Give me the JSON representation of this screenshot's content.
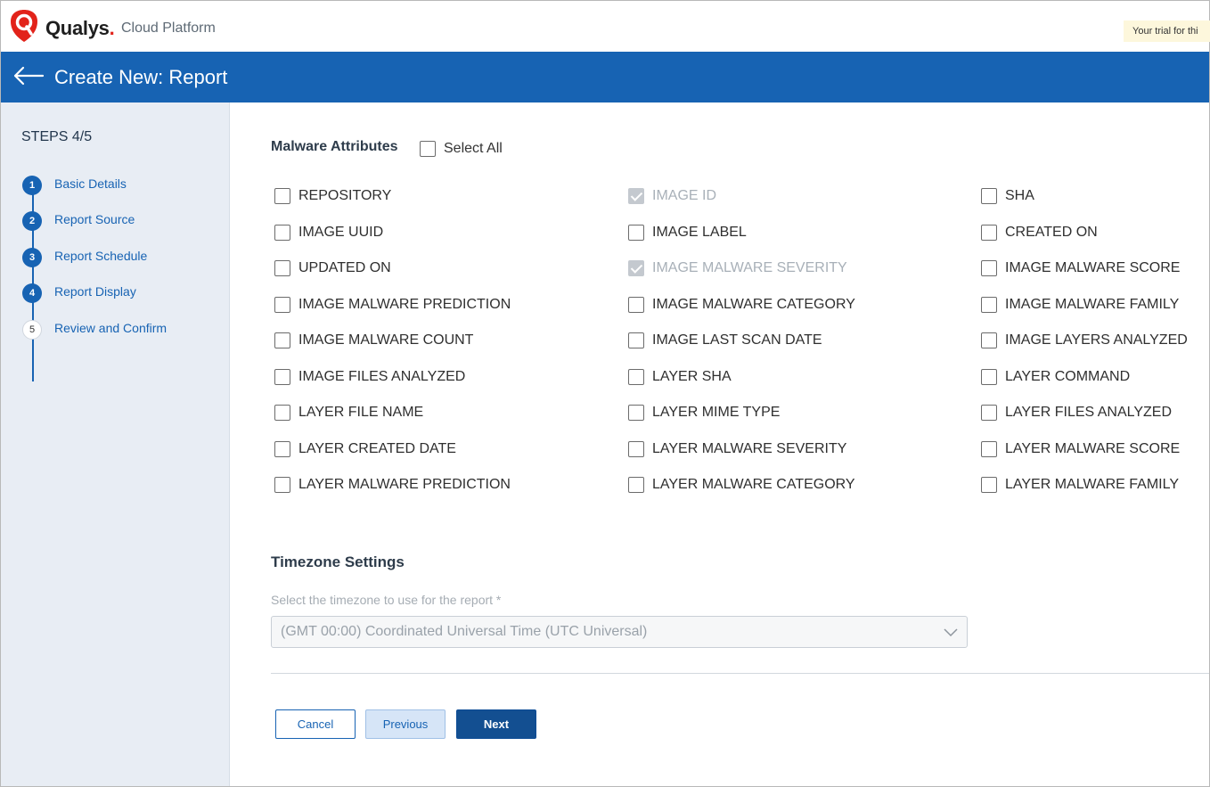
{
  "app": {
    "brand": "Qualys",
    "brand_dot": ".",
    "platform": "Cloud Platform",
    "trial_notice": "Your trial for thi"
  },
  "header": {
    "title": "Create New: Report"
  },
  "sidebar": {
    "steps_label": "STEPS 4/5",
    "steps": [
      {
        "number": "1",
        "label": "Basic Details",
        "state": "done"
      },
      {
        "number": "2",
        "label": "Report Source",
        "state": "done"
      },
      {
        "number": "3",
        "label": "Report Schedule",
        "state": "done"
      },
      {
        "number": "4",
        "label": "Report Display",
        "state": "current"
      },
      {
        "number": "5",
        "label": "Review and Confirm",
        "state": "pending"
      }
    ]
  },
  "attributes": {
    "title": "Malware Attributes",
    "select_all_label": "Select All",
    "select_all_checked": false,
    "columns": [
      [
        {
          "label": "REPOSITORY",
          "checked": false,
          "disabled": false
        },
        {
          "label": "IMAGE UUID",
          "checked": false,
          "disabled": false
        },
        {
          "label": "UPDATED ON",
          "checked": false,
          "disabled": false
        },
        {
          "label": "IMAGE MALWARE PREDICTION",
          "checked": false,
          "disabled": false
        },
        {
          "label": "IMAGE MALWARE COUNT",
          "checked": false,
          "disabled": false
        },
        {
          "label": "IMAGE FILES ANALYZED",
          "checked": false,
          "disabled": false
        },
        {
          "label": "LAYER FILE NAME",
          "checked": false,
          "disabled": false
        },
        {
          "label": "LAYER CREATED DATE",
          "checked": false,
          "disabled": false
        },
        {
          "label": "LAYER MALWARE PREDICTION",
          "checked": false,
          "disabled": false
        }
      ],
      [
        {
          "label": "IMAGE ID",
          "checked": true,
          "disabled": true
        },
        {
          "label": "IMAGE LABEL",
          "checked": false,
          "disabled": false
        },
        {
          "label": "IMAGE MALWARE SEVERITY",
          "checked": true,
          "disabled": true
        },
        {
          "label": "IMAGE MALWARE CATEGORY",
          "checked": false,
          "disabled": false
        },
        {
          "label": "IMAGE LAST SCAN DATE",
          "checked": false,
          "disabled": false
        },
        {
          "label": "LAYER SHA",
          "checked": false,
          "disabled": false
        },
        {
          "label": "LAYER MIME TYPE",
          "checked": false,
          "disabled": false
        },
        {
          "label": "LAYER MALWARE SEVERITY",
          "checked": false,
          "disabled": false
        },
        {
          "label": "LAYER MALWARE CATEGORY",
          "checked": false,
          "disabled": false
        }
      ],
      [
        {
          "label": "SHA",
          "checked": false,
          "disabled": false
        },
        {
          "label": "CREATED ON",
          "checked": false,
          "disabled": false
        },
        {
          "label": "IMAGE MALWARE SCORE",
          "checked": false,
          "disabled": false
        },
        {
          "label": "IMAGE MALWARE FAMILY",
          "checked": false,
          "disabled": false
        },
        {
          "label": "IMAGE LAYERS ANALYZED",
          "checked": false,
          "disabled": false
        },
        {
          "label": "LAYER COMMAND",
          "checked": false,
          "disabled": false
        },
        {
          "label": "LAYER FILES ANALYZED",
          "checked": false,
          "disabled": false
        },
        {
          "label": "LAYER MALWARE SCORE",
          "checked": false,
          "disabled": false
        },
        {
          "label": "LAYER MALWARE FAMILY",
          "checked": false,
          "disabled": false
        }
      ]
    ]
  },
  "timezone": {
    "title": "Timezone Settings",
    "hint": "Select the timezone to use for the report *",
    "value": "(GMT 00:00) Coordinated Universal Time (UTC Universal)"
  },
  "buttons": {
    "cancel": "Cancel",
    "previous": "Previous",
    "next": "Next"
  },
  "colors": {
    "brand_blue": "#1763b3",
    "brand_red": "#e2231a",
    "sidebar_bg": "#e8edf4",
    "next_button": "#134f91"
  },
  "icons": {
    "logo": "qualys-shield-logo",
    "back": "back-arrow-icon",
    "dropdown": "chevron-down-icon"
  }
}
